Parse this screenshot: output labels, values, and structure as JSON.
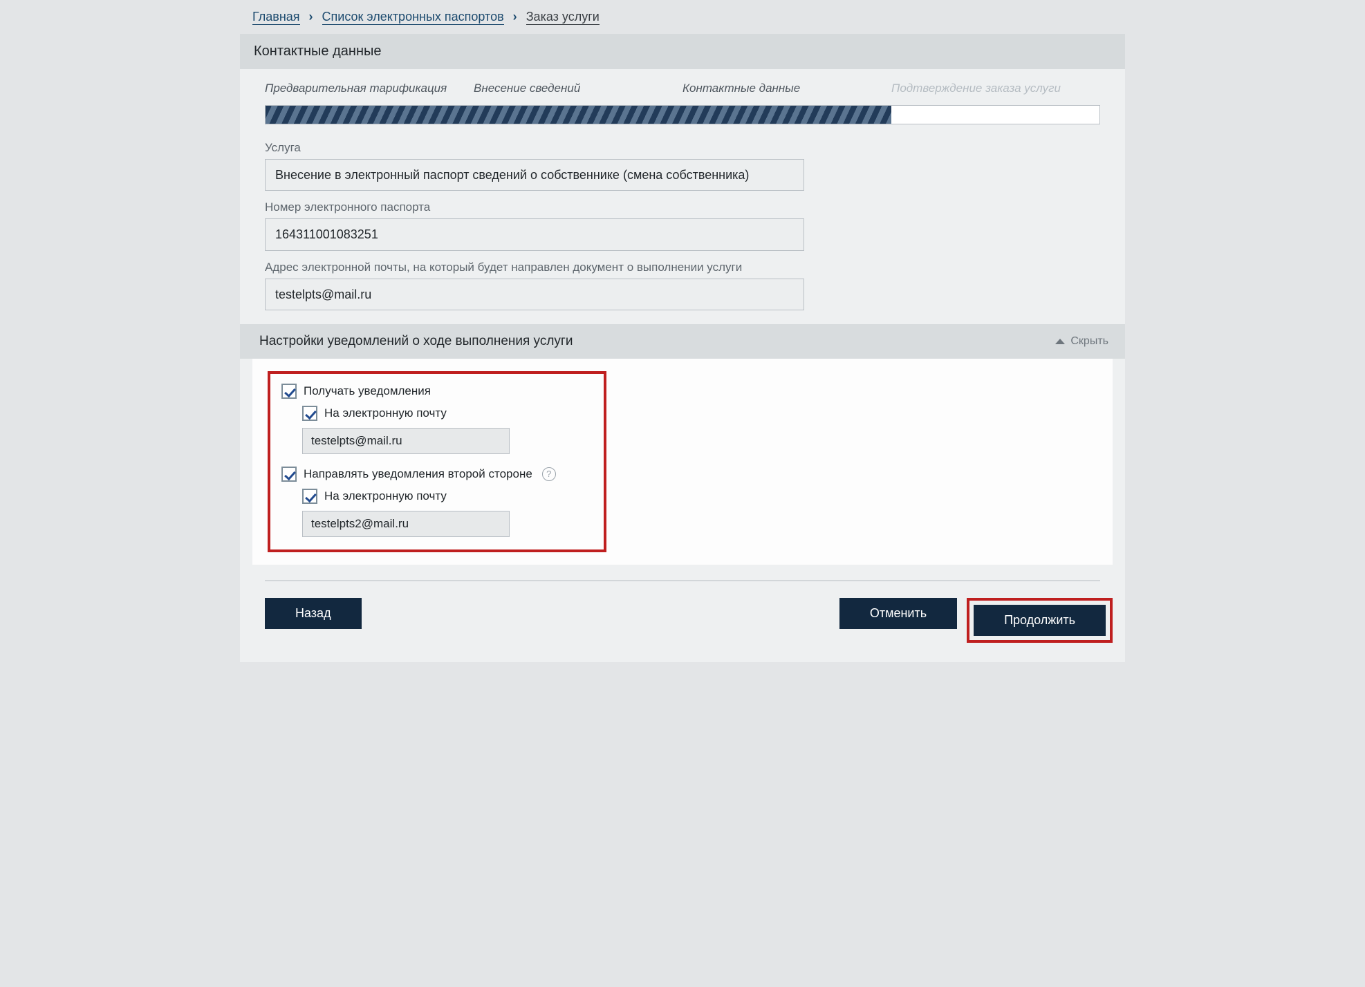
{
  "breadcrumbs": {
    "home": "Главная",
    "list": "Список электронных паспортов",
    "current": "Заказ услуги"
  },
  "panel_title": "Контактные данные",
  "steps": {
    "s1": "Предварительная тарификация",
    "s2": "Внесение сведений",
    "s3": "Контактные данные",
    "s4": "Подтверждение заказа услуги"
  },
  "fields": {
    "service_label": "Услуга",
    "service_value": "Внесение в электронный паспорт сведений о собственнике (смена собственника)",
    "passport_label": "Номер электронного паспорта",
    "passport_value": "164311001083251",
    "email_label": "Адрес электронной почты, на который будет направлен документ о выполнении услуги",
    "email_value": "testelpts@mail.ru"
  },
  "notif_section": {
    "title": "Настройки уведомлений о ходе выполнения услуги",
    "toggle": "Скрыть",
    "receive": "Получать уведомления",
    "by_email1": "На электронную почту",
    "email1_value": "testelpts@mail.ru",
    "second_party": "Направлять уведомления второй стороне",
    "by_email2": "На электронную почту",
    "email2_value": "testelpts2@mail.ru",
    "help": "?"
  },
  "buttons": {
    "back": "Назад",
    "cancel": "Отменить",
    "continue": "Продолжить"
  }
}
